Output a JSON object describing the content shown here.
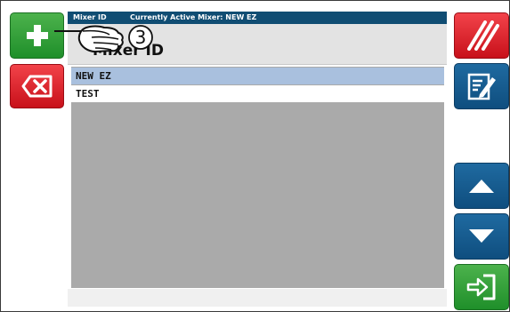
{
  "title_bar": {
    "id_label": "Mixer ID",
    "active_label": "Currently Active Mixer: NEW EZ"
  },
  "panel": {
    "title": "Mixer ID"
  },
  "list": {
    "items": [
      {
        "label": "NEW EZ",
        "selected": true
      },
      {
        "label": "TEST",
        "selected": false
      }
    ]
  },
  "annotation": {
    "step_number": "3"
  },
  "icons": {
    "add": "plus-icon",
    "delete": "backspace-x-icon",
    "clear": "slash-lines-icon",
    "edit": "edit-document-icon",
    "up": "triangle-up-icon",
    "down": "triangle-down-icon",
    "enter": "arrow-into-box-icon",
    "pointer": "pointing-hand-icon"
  },
  "colors": {
    "green": "#2e9e3a",
    "red": "#e0202a",
    "blue": "#155a8a",
    "title_bar": "#104d73",
    "selected_row": "#a9c0de",
    "list_background": "#aaaaaa"
  }
}
